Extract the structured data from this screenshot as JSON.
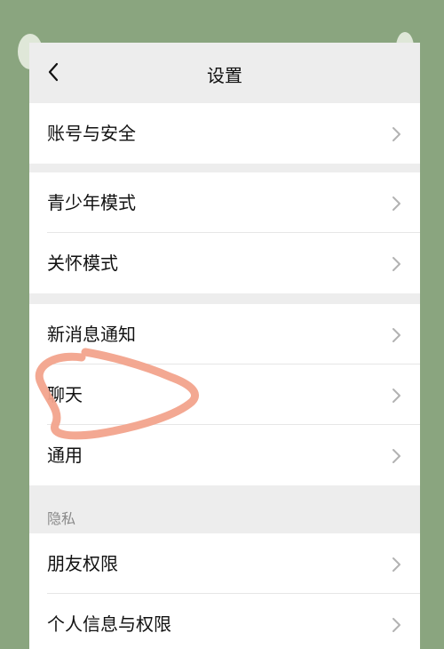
{
  "header": {
    "title": "设置",
    "back_icon": "chevron-left-icon"
  },
  "groups": [
    {
      "items": [
        {
          "label": "账号与安全"
        }
      ]
    },
    {
      "items": [
        {
          "label": "青少年模式"
        },
        {
          "label": "关怀模式"
        }
      ]
    },
    {
      "items": [
        {
          "label": "新消息通知"
        },
        {
          "label": "聊天"
        },
        {
          "label": "通用"
        }
      ]
    },
    {
      "title": "隐私",
      "items": [
        {
          "label": "朋友权限"
        },
        {
          "label": "个人信息与权限"
        }
      ]
    }
  ],
  "colors": {
    "background": "#8aa57f",
    "panel": "#ededed",
    "annotation_stroke": "#f2a38c"
  }
}
